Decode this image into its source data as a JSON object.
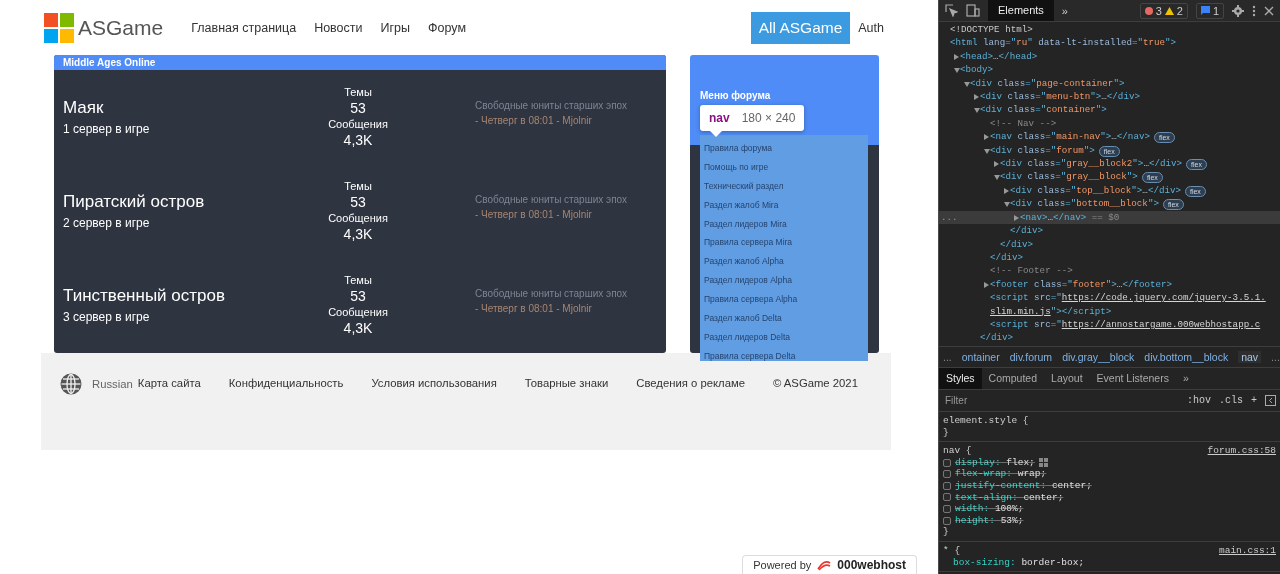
{
  "header": {
    "logo_text": "ASGame",
    "nav": [
      "Главная страница",
      "Новости",
      "Игры",
      "Форум"
    ],
    "primary_button": "All ASGame",
    "auth_link": "Auth"
  },
  "forum": {
    "section_title": "Middle Ages Online",
    "servers": [
      {
        "name": "Маяк",
        "subtitle": "1 сервер в игре",
        "topics_label": "Темы",
        "topics": "53",
        "posts_label": "Сообщения",
        "posts": "4,3K",
        "last_post_title": "Свободные юниты старших эпох",
        "last_post_meta": "- Четверг в 08:01 - Mjolnir"
      },
      {
        "name": "Пиратский остров",
        "subtitle": "2 сервер в игре",
        "topics_label": "Темы",
        "topics": "53",
        "posts_label": "Сообщения",
        "posts": "4,3K",
        "last_post_title": "Свободные юниты старших эпох",
        "last_post_meta": "- Четверг в 08:01 - Mjolnir"
      },
      {
        "name": "Тинственный остров",
        "subtitle": "3 сервер в игре",
        "topics_label": "Темы",
        "topics": "53",
        "posts_label": "Сообщения",
        "posts": "4,3K",
        "last_post_title": "Свободные юниты старших эпох",
        "last_post_meta": "- Четверг в 08:01 - Mjolnir"
      }
    ],
    "menu": {
      "title": "Меню форума",
      "items": [
        "Правила форума",
        "Помощь по игре",
        "Технический раздел",
        "Раздел жалоб Mira",
        "Раздел лидеров Mira",
        "Правила сервера Mira",
        "Раздел жалоб Alpha",
        "Раздел лидеров Alpha",
        "Правила сервера Alpha",
        "Раздел жалоб Delta",
        "Раздел лидеров Delta",
        "Правила сервера Delta"
      ]
    }
  },
  "inspect_tooltip": {
    "tag": "nav",
    "size": "180 × 240"
  },
  "footer": {
    "language": "Russian",
    "links": [
      "Карта сайта",
      "Конфиденциальность",
      "Условия использования",
      "Товарные знаки",
      "Сведения о рекламе"
    ],
    "copyright": "© ASGame 2021"
  },
  "hosting_badge": {
    "prefix": "Powered by",
    "brand": "000webhost"
  },
  "devtools": {
    "tabs": [
      {
        "label": "Elements",
        "selected": true
      }
    ],
    "more_tabs": "»",
    "errors": "3",
    "warnings": "2",
    "messages": "1",
    "gutter_mark": "...",
    "dom_tree": [
      {
        "selected": false,
        "tokens": [
          {
            "text": "<!DOCTYPE html>",
            "kind": "doctype"
          }
        ]
      },
      {
        "selected": false,
        "tokens": [
          {
            "text": "<html",
            "kind": "tag"
          },
          {
            "text": " lang",
            "kind": "attr"
          },
          {
            "text": "=\"",
            "kind": "tag"
          },
          {
            "text": "ru",
            "kind": "value"
          },
          {
            "text": "\"",
            "kind": "tag"
          },
          {
            "text": " data-lt-installed",
            "kind": "attr"
          },
          {
            "text": "=\"",
            "kind": "tag"
          },
          {
            "text": "true",
            "kind": "value"
          },
          {
            "text": "\">",
            "kind": "tag"
          }
        ],
        "children": [
          {
            "selected": false,
            "expanded": false,
            "tokens": [
              {
                "text": "<head>",
                "kind": "tag"
              },
              {
                "text": "…",
                "kind": "plain"
              },
              {
                "text": "</head>",
                "kind": "tag"
              }
            ]
          },
          {
            "selected": false,
            "expanded": true,
            "tokens": [
              {
                "text": "<body>",
                "kind": "tag"
              }
            ],
            "children": [
              {
                "selected": false,
                "expanded": true,
                "tokens": [
                  {
                    "text": "<div",
                    "kind": "tag"
                  },
                  {
                    "text": " class",
                    "kind": "attr"
                  },
                  {
                    "text": "=\"",
                    "kind": "tag"
                  },
                  {
                    "text": "page-container",
                    "kind": "value"
                  },
                  {
                    "text": "\">",
                    "kind": "tag"
                  }
                ],
                "children": [
                  {
                    "selected": false,
                    "expanded": false,
                    "tokens": [
                      {
                        "text": "<div",
                        "kind": "tag"
                      },
                      {
                        "text": " class",
                        "kind": "attr"
                      },
                      {
                        "text": "=\"",
                        "kind": "tag"
                      },
                      {
                        "text": "menu-btn",
                        "kind": "value"
                      },
                      {
                        "text": "\">",
                        "kind": "tag"
                      },
                      {
                        "text": "…",
                        "kind": "plain"
                      },
                      {
                        "text": "</div>",
                        "kind": "tag"
                      }
                    ]
                  },
                  {
                    "selected": false,
                    "expanded": true,
                    "tokens": [
                      {
                        "text": "<div",
                        "kind": "tag"
                      },
                      {
                        "text": " class",
                        "kind": "attr"
                      },
                      {
                        "text": "=\"",
                        "kind": "tag"
                      },
                      {
                        "text": "container",
                        "kind": "value"
                      },
                      {
                        "text": "\">",
                        "kind": "tag"
                      }
                    ],
                    "close": [
                      {
                        "text": "</div>",
                        "kind": "tag"
                      }
                    ],
                    "children": [
                      {
                        "selected": false,
                        "tokens": [
                          {
                            "text": "<!-- Nav -->",
                            "kind": "comment"
                          }
                        ]
                      },
                      {
                        "selected": false,
                        "expanded": false,
                        "badge": "flex",
                        "tokens": [
                          {
                            "text": "<nav",
                            "kind": "tag"
                          },
                          {
                            "text": " class",
                            "kind": "attr"
                          },
                          {
                            "text": "=\"",
                            "kind": "tag"
                          },
                          {
                            "text": "main-nav",
                            "kind": "value"
                          },
                          {
                            "text": "\">",
                            "kind": "tag"
                          },
                          {
                            "text": "…",
                            "kind": "plain"
                          },
                          {
                            "text": "</nav>",
                            "kind": "tag"
                          }
                        ]
                      },
                      {
                        "selected": false,
                        "expanded": true,
                        "badge": "flex",
                        "tokens": [
                          {
                            "text": "<div",
                            "kind": "tag"
                          },
                          {
                            "text": " class",
                            "kind": "attr"
                          },
                          {
                            "text": "=\"",
                            "kind": "tag"
                          },
                          {
                            "text": "forum",
                            "kind": "value"
                          },
                          {
                            "text": "\">",
                            "kind": "tag"
                          }
                        ],
                        "close": [
                          {
                            "text": "</div>",
                            "kind": "tag"
                          }
                        ],
                        "children": [
                          {
                            "selected": false,
                            "expanded": false,
                            "badge": "flex",
                            "tokens": [
                              {
                                "text": "<div",
                                "kind": "tag"
                              },
                              {
                                "text": " class",
                                "kind": "attr"
                              },
                              {
                                "text": "=\"",
                                "kind": "tag"
                              },
                              {
                                "text": "gray__block2",
                                "kind": "value"
                              },
                              {
                                "text": "\">",
                                "kind": "tag"
                              },
                              {
                                "text": "…",
                                "kind": "plain"
                              },
                              {
                                "text": "</div>",
                                "kind": "tag"
                              }
                            ]
                          },
                          {
                            "selected": false,
                            "expanded": true,
                            "badge": "flex",
                            "tokens": [
                              {
                                "text": "<div",
                                "kind": "tag"
                              },
                              {
                                "text": " class",
                                "kind": "attr"
                              },
                              {
                                "text": "=\"",
                                "kind": "tag"
                              },
                              {
                                "text": "gray__block",
                                "kind": "value"
                              },
                              {
                                "text": "\">",
                                "kind": "tag"
                              }
                            ],
                            "close": [
                              {
                                "text": "</div>",
                                "kind": "tag"
                              }
                            ],
                            "children": [
                              {
                                "selected": false,
                                "expanded": false,
                                "badge": "flex",
                                "tokens": [
                                  {
                                    "text": "<div",
                                    "kind": "tag"
                                  },
                                  {
                                    "text": " class",
                                    "kind": "attr"
                                  },
                                  {
                                    "text": "=\"",
                                    "kind": "tag"
                                  },
                                  {
                                    "text": "top__block",
                                    "kind": "value"
                                  },
                                  {
                                    "text": "\">",
                                    "kind": "tag"
                                  },
                                  {
                                    "text": "…",
                                    "kind": "plain"
                                  },
                                  {
                                    "text": "</div>",
                                    "kind": "tag"
                                  }
                                ]
                              },
                              {
                                "selected": false,
                                "expanded": true,
                                "badge": "flex",
                                "tokens": [
                                  {
                                    "text": "<div",
                                    "kind": "tag"
                                  },
                                  {
                                    "text": " class",
                                    "kind": "attr"
                                  },
                                  {
                                    "text": "=\"",
                                    "kind": "tag"
                                  },
                                  {
                                    "text": "bottom__block",
                                    "kind": "value"
                                  },
                                  {
                                    "text": "\">",
                                    "kind": "tag"
                                  }
                                ],
                                "close": [
                                  {
                                    "text": "</div>",
                                    "kind": "tag"
                                  }
                                ],
                                "children": [
                                  {
                                    "selected": true,
                                    "expanded": false,
                                    "tokens": [
                                      {
                                        "text": "<nav>",
                                        "kind": "tag"
                                      },
                                      {
                                        "text": "…",
                                        "kind": "plain"
                                      },
                                      {
                                        "text": "</nav>",
                                        "kind": "tag"
                                      },
                                      {
                                        "text": " == $0",
                                        "kind": "ref"
                                      }
                                    ]
                                  }
                                ]
                              }
                            ]
                          }
                        ]
                      },
                      {
                        "selected": false,
                        "tokens": [
                          {
                            "text": "<!-- Footer -->",
                            "kind": "comment"
                          }
                        ]
                      },
                      {
                        "selected": false,
                        "expanded": false,
                        "tokens": [
                          {
                            "text": "<footer",
                            "kind": "tag"
                          },
                          {
                            "text": " class",
                            "kind": "attr"
                          },
                          {
                            "text": "=\"",
                            "kind": "tag"
                          },
                          {
                            "text": "footer",
                            "kind": "value"
                          },
                          {
                            "text": "\">",
                            "kind": "tag"
                          },
                          {
                            "text": "…",
                            "kind": "plain"
                          },
                          {
                            "text": "</footer>",
                            "kind": "tag"
                          }
                        ]
                      },
                      {
                        "selected": false,
                        "tokens": [
                          {
                            "text": "<script",
                            "kind": "tag"
                          },
                          {
                            "text": " src",
                            "kind": "attr"
                          },
                          {
                            "text": "=\"",
                            "kind": "tag"
                          },
                          {
                            "text": "https://code.jquery.com/jquery-3.5.1.slim.min.js",
                            "kind": "link"
                          },
                          {
                            "text": "\">",
                            "kind": "tag"
                          },
                          {
                            "text": "</script>",
                            "kind": "tag"
                          }
                        ]
                      },
                      {
                        "selected": false,
                        "tokens": [
                          {
                            "text": "<script",
                            "kind": "tag"
                          },
                          {
                            "text": " src",
                            "kind": "attr"
                          },
                          {
                            "text": "=\"",
                            "kind": "tag"
                          },
                          {
                            "text": "https://annostargame.000webhostapp.c",
                            "kind": "link"
                          }
                        ]
                      }
                    ]
                  }
                ]
              }
            ]
          }
        ]
      }
    ],
    "breadcrumb_left": "...",
    "breadcrumb_right": "...",
    "breadcrumbs": [
      {
        "label": "ontainer",
        "selected": false
      },
      {
        "label": "div.forum",
        "selected": false
      },
      {
        "label": "div.gray__block",
        "selected": false
      },
      {
        "label": "div.bottom__block",
        "selected": false
      },
      {
        "label": "nav",
        "selected": true
      }
    ],
    "pane_tabs": [
      {
        "label": "Styles",
        "selected": true
      },
      {
        "label": "Computed",
        "selected": false
      },
      {
        "label": "Layout",
        "selected": false
      },
      {
        "label": "Event Listeners",
        "selected": false
      }
    ],
    "pane_more": "»",
    "filter": {
      "placeholder": "Filter",
      "hov": ":hov",
      "cls": ".cls",
      "add": "+"
    },
    "rules": [
      {
        "selector": "element.style {",
        "close": "}"
      },
      {
        "selector": "nav {",
        "source": "forum.css:58",
        "close": "}",
        "declarations": [
          {
            "property": "display:",
            "value": "flex;",
            "enabled": false,
            "grid_icon": true
          },
          {
            "property": "flex-wrap:",
            "value": "wrap;",
            "enabled": false
          },
          {
            "property": "justify-content:",
            "value": "center;",
            "enabled": false
          },
          {
            "property": "text-align:",
            "value": "center;",
            "enabled": false
          },
          {
            "property": "width:",
            "value": "100%;",
            "enabled": false
          },
          {
            "property": "height:",
            "value": "53%;",
            "enabled": false
          }
        ]
      },
      {
        "selector": "* {",
        "source": "main.css:1",
        "declarations": [
          {
            "property": "box-sizing:",
            "value": "border-box;",
            "enabled": true
          }
        ]
      }
    ]
  }
}
